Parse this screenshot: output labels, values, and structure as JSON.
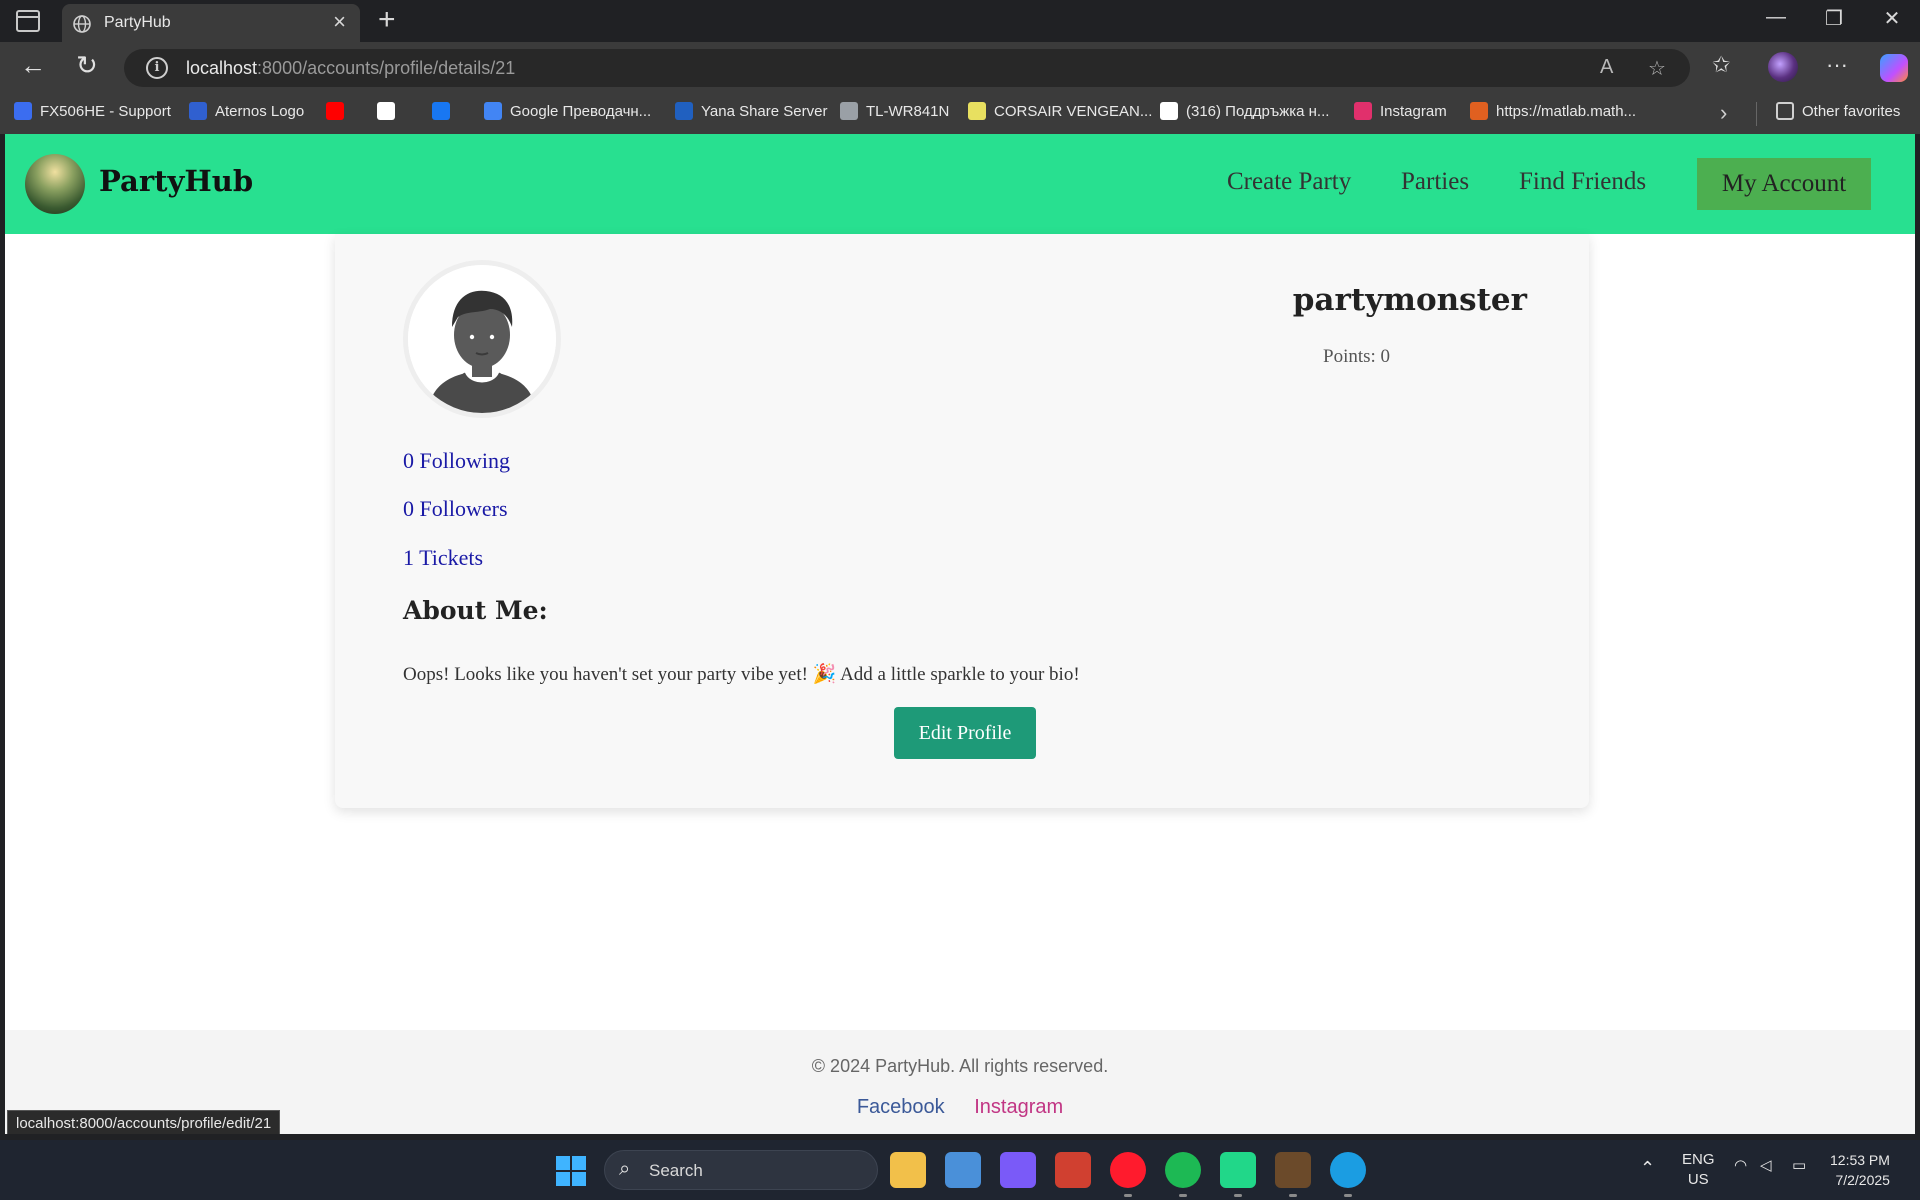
{
  "browser": {
    "tab_title": "PartyHub",
    "url_host": "localhost",
    "url_path": ":8000/accounts/profile/details/21",
    "new_tab_label": "+",
    "more_label": "···",
    "other_favorites": "Other favorites",
    "bookmarks": [
      {
        "label": "FX506HE - Support",
        "icon": "asus-icon",
        "color": "#3b6df0"
      },
      {
        "label": "Aternos Logo",
        "icon": "aternos-icon",
        "color": "#3060d0"
      },
      {
        "label": "",
        "icon": "youtube-icon",
        "color": "#ff0000"
      },
      {
        "label": "",
        "icon": "google-icon",
        "color": "#ffffff"
      },
      {
        "label": "",
        "icon": "facebook-icon",
        "color": "#1877f2"
      },
      {
        "label": "Google Преводачн...",
        "icon": "google-translate-icon",
        "color": "#4285f4"
      },
      {
        "label": "Yana Share Server",
        "icon": "dsm-icon",
        "color": "#2060c0"
      },
      {
        "label": "TL-WR841N",
        "icon": "globe-icon",
        "color": "#9aa0a6"
      },
      {
        "label": "CORSAIR VENGEAN...",
        "icon": "corsair-icon",
        "color": "#e8e060"
      },
      {
        "label": "(316) Поддръжка н...",
        "icon": "youtube-icon",
        "color": "#ffffff"
      },
      {
        "label": "Instagram",
        "icon": "instagram-icon",
        "color": "#e1306c"
      },
      {
        "label": "https://matlab.math...",
        "icon": "matlab-icon",
        "color": "#e06020"
      }
    ],
    "status_url": "localhost:8000/accounts/profile/edit/21"
  },
  "site": {
    "brand": "PartyHub",
    "nav": [
      "Create Party",
      "Parties",
      "Find Friends"
    ],
    "account_button": "My Account",
    "colors": {
      "navbar": "#28e090",
      "account_button": "#4caf50",
      "edit_button": "#1e9a78",
      "link": "#1a1aa6"
    }
  },
  "profile": {
    "username": "partymonster",
    "points_text": "Points: 0",
    "following_text": "0 Following",
    "followers_text": "0 Followers",
    "tickets_text": "1 Tickets",
    "about_heading": "About Me:",
    "bio": "Oops! Looks like you haven't set your party vibe yet! 🎉 Add a little sparkle to your bio!",
    "edit_button": "Edit Profile"
  },
  "footer": {
    "copyright": "© 2024 PartyHub. All rights reserved.",
    "links": [
      {
        "label": "Facebook",
        "color": "#3b5998"
      },
      {
        "label": "Instagram",
        "color": "#c13584"
      }
    ]
  },
  "taskbar": {
    "search_label": "Search",
    "language_top": "ENG",
    "language_bottom": "US",
    "time": "12:53 PM",
    "date": "7/2/2025",
    "apps": [
      {
        "name": "file-explorer-icon",
        "color": "#f2c04a"
      },
      {
        "name": "control-panel-icon",
        "color": "#4a90d9"
      },
      {
        "name": "copilot-app-icon",
        "color": "#7a5af8"
      },
      {
        "name": "office-app-icon",
        "color": "#d04030"
      },
      {
        "name": "opera-icon",
        "color": "#ff1b2d"
      },
      {
        "name": "spotify-icon",
        "color": "#1db954"
      },
      {
        "name": "pycharm-icon",
        "color": "#21d789"
      },
      {
        "name": "minecraft-icon",
        "color": "#6b4a2a"
      },
      {
        "name": "edge-icon",
        "color": "#1b9de2"
      }
    ]
  }
}
